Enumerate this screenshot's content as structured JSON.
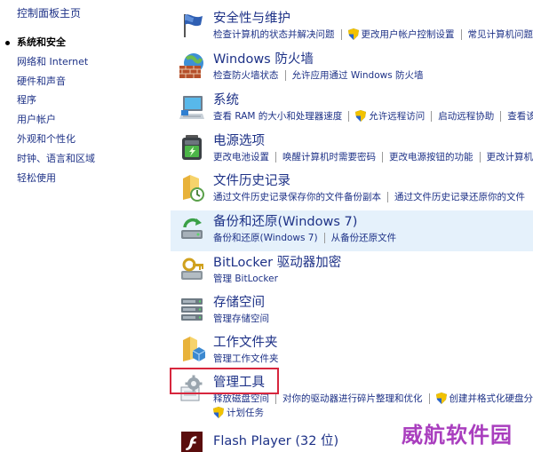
{
  "nav": {
    "home": "控制面板主页",
    "items": [
      {
        "label": "系统和安全",
        "current": true
      },
      {
        "label": "网络和 Internet",
        "current": false
      },
      {
        "label": "硬件和声音",
        "current": false
      },
      {
        "label": "程序",
        "current": false
      },
      {
        "label": "用户帐户",
        "current": false
      },
      {
        "label": "外观和个性化",
        "current": false
      },
      {
        "label": "时钟、语言和区域",
        "current": false
      },
      {
        "label": "轻松使用",
        "current": false
      }
    ]
  },
  "categories": [
    {
      "title": "安全性与维护",
      "icon": "flag-icon",
      "links": [
        "检查计算机的状态并解决问题",
        "更改用户帐户控制设置",
        "常见计算机问题疑难解答"
      ]
    },
    {
      "title": "Windows 防火墙",
      "icon": "firewall-icon",
      "links": [
        "检查防火墙状态",
        "允许应用通过 Windows 防火墙"
      ]
    },
    {
      "title": "系统",
      "icon": "computer-icon",
      "links": [
        "查看 RAM 的大小和处理器速度",
        "允许远程访问",
        "启动远程协助",
        "查看该计算机的名称"
      ]
    },
    {
      "title": "电源选项",
      "icon": "battery-icon",
      "links": [
        "更改电池设置",
        "唤醒计算机时需要密码",
        "更改电源按钮的功能",
        "更改计算机睡眠时间"
      ]
    },
    {
      "title": "文件历史记录",
      "icon": "file-history-icon",
      "links": [
        "通过文件历史记录保存你的文件备份副本",
        "通过文件历史记录还原你的文件"
      ]
    },
    {
      "title": "备份和还原(Windows 7)",
      "icon": "backup-icon",
      "links": [
        "备份和还原(Windows 7)",
        "从备份还原文件"
      ]
    },
    {
      "title": "BitLocker 驱动器加密",
      "icon": "bitlocker-icon",
      "links": [
        "管理 BitLocker"
      ]
    },
    {
      "title": "存储空间",
      "icon": "storage-icon",
      "links": [
        "管理存储空间"
      ]
    },
    {
      "title": "工作文件夹",
      "icon": "work-folders-icon",
      "links": [
        "管理工作文件夹"
      ]
    },
    {
      "title": "管理工具",
      "icon": "admin-tools-icon",
      "links": [
        "释放磁盘空间",
        "对你的驱动器进行碎片整理和优化",
        "创建并格式化硬盘分区"
      ],
      "links2": [
        "计划任务"
      ]
    },
    {
      "title": "Flash Player (32 位)",
      "icon": "flash-icon",
      "links": []
    }
  ],
  "watermark": "威航软件园",
  "colors": {
    "link": "#1e3287",
    "highlight": "#e5f1fb",
    "redbox": "#d7263d",
    "watermark": "#a02ab8"
  }
}
